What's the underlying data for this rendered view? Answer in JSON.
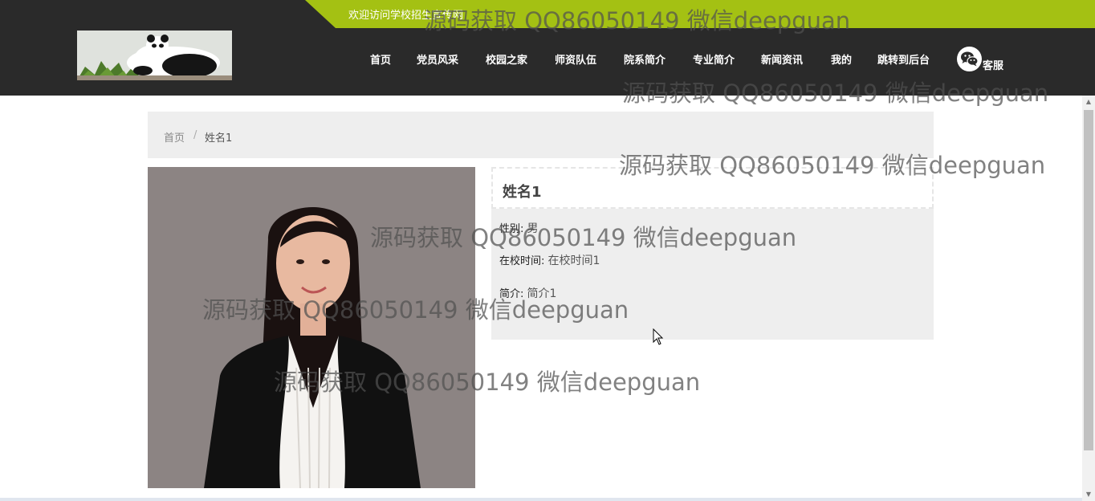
{
  "header": {
    "welcome": "欢迎访问学校招生宣传网",
    "nav": [
      "首页",
      "党员风采",
      "校园之家",
      "师资队伍",
      "院系简介",
      "专业简介",
      "新闻资讯",
      "我的",
      "跳转到后台"
    ],
    "kefu_label": "客服"
  },
  "breadcrumb": {
    "home": "首页",
    "separator": "/",
    "current": "姓名1"
  },
  "detail": {
    "name": "姓名1",
    "fields": [
      {
        "label": "性别:",
        "value": "男"
      },
      {
        "label": "在校时间:",
        "value": "在校时间1"
      },
      {
        "label": "简介:",
        "value": "简介1"
      }
    ]
  },
  "watermark": "源码获取 QQ86050149 微信deepguan",
  "colors": {
    "header_bg": "#2a2a2a",
    "accent_green": "#a4c113",
    "panel_bg": "#eeeeee"
  },
  "icons": {
    "kefu": "wechat-icon",
    "logo": "panda-logo"
  }
}
